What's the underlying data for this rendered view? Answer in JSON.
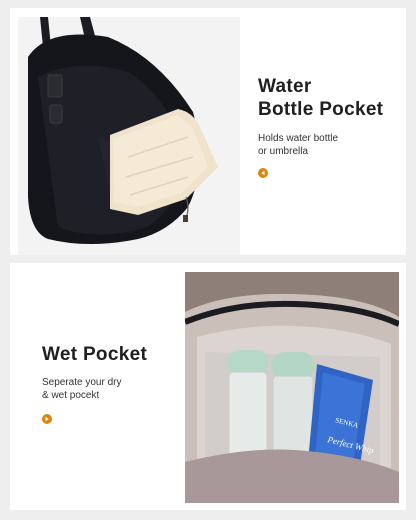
{
  "sections": [
    {
      "title_line1": "Water",
      "title_line2": "Bottle Pocket",
      "desc_line1": "Holds water bottle",
      "desc_line2": "or umbrella",
      "photo_icon": "bag-side-pocket-photo"
    },
    {
      "title_line1": "Wet Pocket",
      "desc_line1": "Seperate your dry",
      "desc_line2": "& wet pocekt",
      "photo_icon": "wet-pocket-photo",
      "bottle_label_brand": "SENKA",
      "bottle_label_product": "Perfect Whip"
    }
  ],
  "colors": {
    "accent": "#d9850f",
    "background": "#eeeeee",
    "card": "#ffffff"
  },
  "icons": {
    "pointer": "play-left-icon"
  }
}
